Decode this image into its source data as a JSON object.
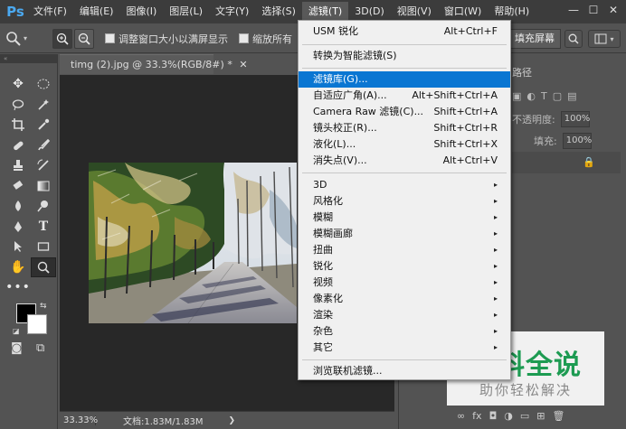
{
  "menubar": {
    "logo": "Ps",
    "items": [
      "文件(F)",
      "编辑(E)",
      "图像(I)",
      "图层(L)",
      "文字(Y)",
      "选择(S)",
      "滤镜(T)",
      "3D(D)",
      "视图(V)",
      "窗口(W)",
      "帮助(H)"
    ],
    "active_index": 6,
    "window_controls": [
      "—",
      "☐",
      "✕"
    ]
  },
  "options": {
    "resize_window_label": "调整窗口大小以满屏显示",
    "zoom_all_label": "缩放所有",
    "fill_screen_label": "填充屏幕"
  },
  "document": {
    "tab_title": "timg (2).jpg @ 33.3%(RGB/8#) *",
    "close": "✕",
    "zoom": "33.33%",
    "doc_info": "文档:1.83M/1.83M"
  },
  "right_panel": {
    "tab_label": "路径",
    "opacity_label": "不透明度:",
    "opacity_value": "100%",
    "fill_label": "填充:",
    "fill_value": "100%"
  },
  "filter_menu": {
    "items": [
      {
        "label": "USM 锐化",
        "shortcut": "Alt+Ctrl+F"
      },
      {
        "label": "转换为智能滤镜(S)",
        "shortcut": ""
      },
      {
        "label": "滤镜库(G)...",
        "shortcut": ""
      },
      {
        "label": "自适应广角(A)...",
        "shortcut": "Alt+Shift+Ctrl+A"
      },
      {
        "label": "Camera Raw 滤镜(C)...",
        "shortcut": "Shift+Ctrl+A"
      },
      {
        "label": "镜头校正(R)...",
        "shortcut": "Shift+Ctrl+R"
      },
      {
        "label": "液化(L)...",
        "shortcut": "Shift+Ctrl+X"
      },
      {
        "label": "消失点(V)...",
        "shortcut": "Alt+Ctrl+V"
      },
      {
        "label": "3D",
        "shortcut": "▸"
      },
      {
        "label": "风格化",
        "shortcut": "▸"
      },
      {
        "label": "模糊",
        "shortcut": "▸"
      },
      {
        "label": "模糊画廊",
        "shortcut": "▸"
      },
      {
        "label": "扭曲",
        "shortcut": "▸"
      },
      {
        "label": "锐化",
        "shortcut": "▸"
      },
      {
        "label": "视频",
        "shortcut": "▸"
      },
      {
        "label": "像素化",
        "shortcut": "▸"
      },
      {
        "label": "渲染",
        "shortcut": "▸"
      },
      {
        "label": "杂色",
        "shortcut": "▸"
      },
      {
        "label": "其它",
        "shortcut": "▸"
      },
      {
        "label": "浏览联机滤镜...",
        "shortcut": ""
      }
    ],
    "highlighted_index": 2
  },
  "watermark": {
    "title": "百科全说",
    "subtitle": "助你轻松解决"
  },
  "colors": {
    "highlight": "#0a76d2",
    "watermark_green": "#1d9b52"
  }
}
